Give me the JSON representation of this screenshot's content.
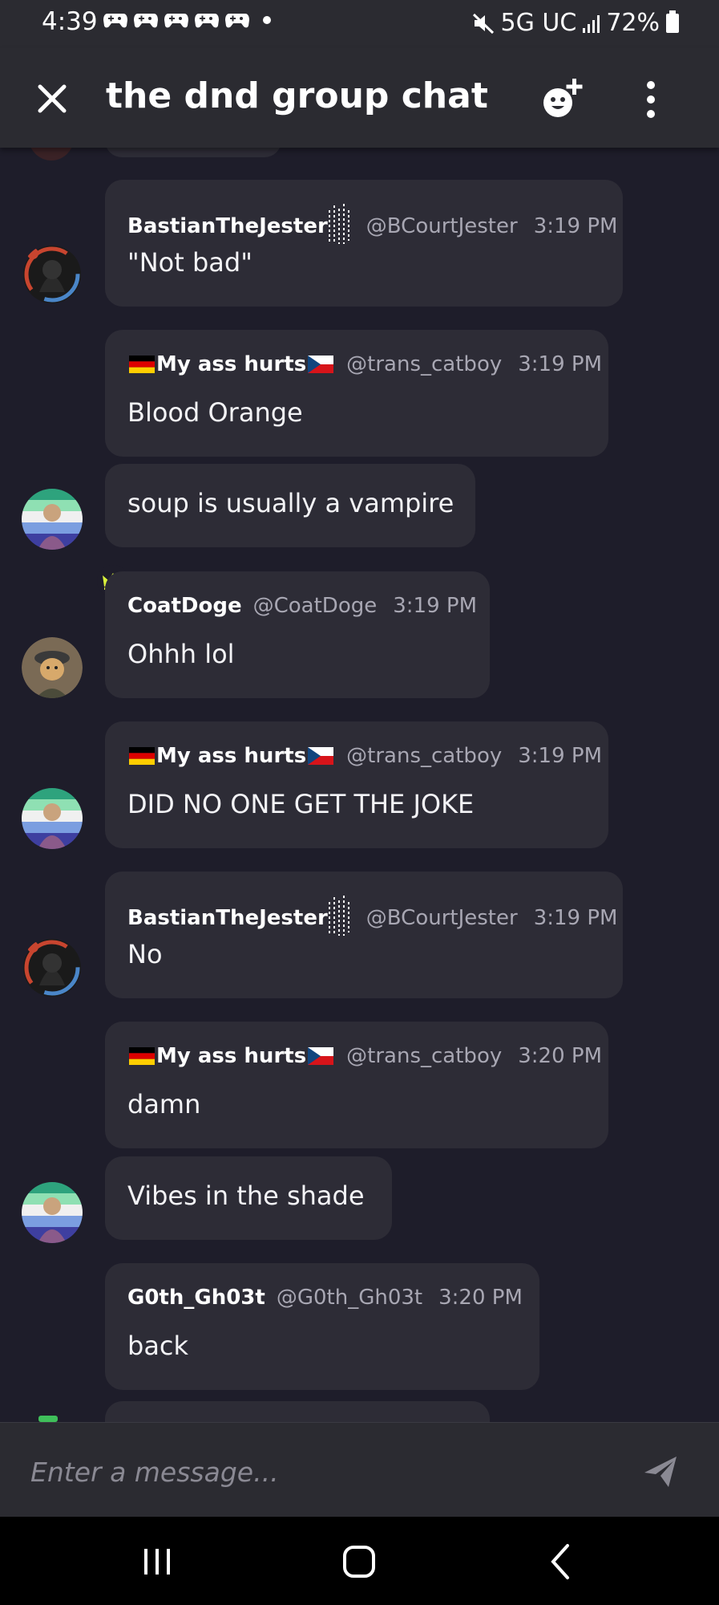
{
  "status_bar": {
    "time": "4:39",
    "network": "5G UC",
    "battery": "72%",
    "notification_icon": "game-controller-icon"
  },
  "header": {
    "title": "the dnd group chat",
    "close_icon": "close-icon",
    "add_icon": "add-member-icon",
    "more_icon": "more-vertical-icon"
  },
  "messages": [
    {
      "author": "BastianTheJester",
      "handle": "@BCourtJester",
      "time": "3:19 PM",
      "text": "\"Not bad\""
    },
    {
      "author": "My ass hurts",
      "handle": "@trans_catboy",
      "time": "3:19 PM",
      "text": "Blood Orange"
    },
    {
      "text": "soup is usually a vampire"
    },
    {
      "author": "CoatDoge",
      "handle": "@CoatDoge",
      "time": "3:19 PM",
      "text": "Ohhh lol",
      "badge": "crown-icon"
    },
    {
      "author": "My ass hurts",
      "handle": "@trans_catboy",
      "time": "3:19 PM",
      "text": "DID NO ONE GET THE JOKE"
    },
    {
      "author": "BastianTheJester",
      "handle": "@BCourtJester",
      "time": "3:19 PM",
      "text": "No"
    },
    {
      "author": "My ass hurts",
      "handle": "@trans_catboy",
      "time": "3:20 PM",
      "text": "damn"
    },
    {
      "text": "Vibes in the shade"
    },
    {
      "author": "G0th_Gh03t",
      "handle": "@G0th_Gh03t",
      "time": "3:20 PM",
      "text": "back"
    }
  ],
  "input": {
    "placeholder": "Enter a message...",
    "send_icon": "send-icon"
  },
  "nav": {
    "recents_icon": "recents-icon",
    "home_icon": "home-icon",
    "back_icon": "back-icon"
  },
  "colors": {
    "background": "#1e1d2a",
    "bubble": "#2d2c36",
    "header": "#2b2b31",
    "muted_text": "#a8a7b3",
    "crown": "#d9f23b"
  }
}
